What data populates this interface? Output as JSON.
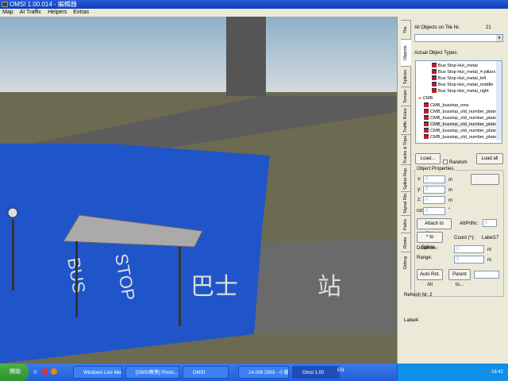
{
  "window": {
    "title": "OMSI 1.00.014 - 編輯器"
  },
  "menu": [
    "Map",
    "AI Traffic",
    "Helpers",
    "Extras"
  ],
  "panel": {
    "tabs": [
      "Tile",
      "Objects",
      "Splines",
      "Terrain",
      "Traffic Rules",
      "Tracks & Trips",
      "Spline-Rep.",
      "Signal Rts",
      "Paths",
      "Roots",
      "Debug"
    ],
    "all_objects_label": "All Objects on Tile Nr.",
    "tile_count": "21",
    "actual_types_label": "Actual Object Types:",
    "tree": [
      "Bus Stop Hut_metal",
      "Bus Stop Hut_metal_4 pillars",
      "Bus Stop Hut_metal_left",
      "Bus Stop Hut_metal_middle",
      "Bus Stop Hut_metal_right",
      "CMB",
      "CMB_busstop_new",
      "CMB_busstop_old_number_plate",
      "CMB_busstop_old_number_plate(bl",
      "CMB_busstop_old_number_plate(gr",
      "CMB_busstop_old_number_plate(re",
      "CMB_busstop_old_number_plate(ye"
    ],
    "load": "Load...",
    "random": "Random",
    "load_all": "Load all",
    "props_title": "Object Properties",
    "x_label": "x:",
    "y_label": "y:",
    "z_label": "z:",
    "rot_label": "rot:",
    "x": "0",
    "y": "0",
    "z": "0",
    "rot": "0",
    "unit_m": "m",
    "unit_deg": "°",
    "attach": "Attach to Object...",
    "attprnr_label": "AttPrtNr.:",
    "attprnr": "0",
    "to_spline": "^ to Spline...",
    "count_label": "Count (^):",
    "count_value": "Label17",
    "distance_label": "Distance:",
    "range_label": "Range:",
    "distance": "0",
    "range": "0",
    "auto_rot": "Auto Rot. All",
    "parent_to": "Parent to...",
    "refresh": "Refresh Nr. 2",
    "label4": "Label4"
  },
  "scene": {
    "road_text": [
      "BUS",
      "STOP",
      "巴士",
      "站"
    ]
  },
  "taskbar": {
    "start": "開始",
    "items": [
      "Windows Live Messen...",
      "[OMSI教學] Photo...",
      "OMSI",
      "14.006 2903 - 小畫家",
      "Omsi 1.00"
    ],
    "lang": "EN",
    "clock": "16:42"
  }
}
